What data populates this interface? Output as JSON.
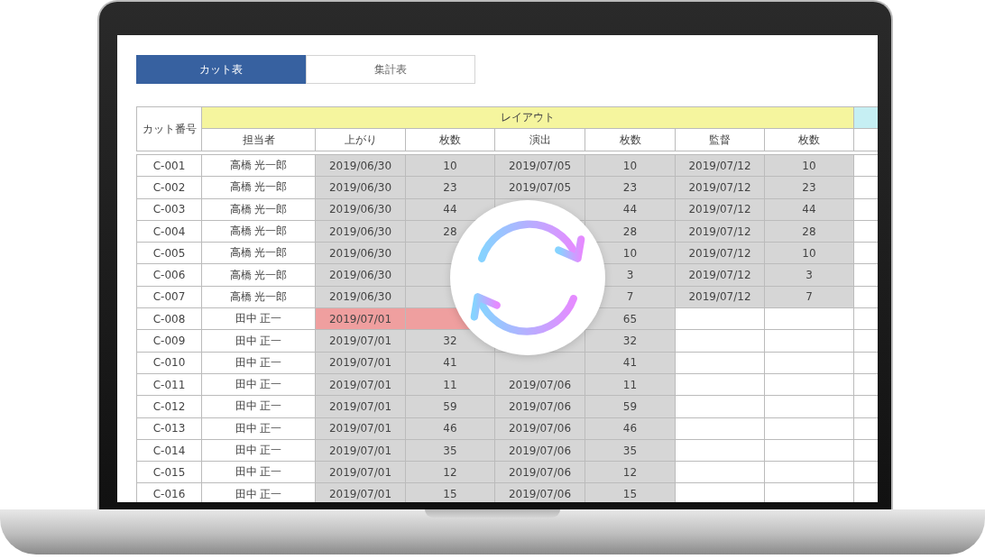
{
  "tabs": [
    {
      "label": "カット表",
      "selected": true
    },
    {
      "label": "集計表",
      "selected": false
    }
  ],
  "table": {
    "corner": "カット番号",
    "group": "レイアウト",
    "columns": [
      "担当者",
      "上がり",
      "枚数",
      "演出",
      "枚数",
      "監督",
      "枚数"
    ],
    "rows": [
      {
        "cut": "C-001",
        "staff": "高橋 光一郎",
        "up": {
          "done": true,
          "late": false,
          "date": "2019/06/30",
          "count": "10"
        },
        "direction": {
          "done": true,
          "late": false,
          "date": "2019/07/05",
          "count": "10"
        },
        "director": {
          "done": true,
          "late": false,
          "date": "2019/07/12",
          "count": "10"
        }
      },
      {
        "cut": "C-002",
        "staff": "高橋 光一郎",
        "up": {
          "done": true,
          "late": false,
          "date": "2019/06/30",
          "count": "23"
        },
        "direction": {
          "done": true,
          "late": false,
          "date": "2019/07/05",
          "count": "23"
        },
        "director": {
          "done": true,
          "late": false,
          "date": "2019/07/12",
          "count": "23"
        }
      },
      {
        "cut": "C-003",
        "staff": "高橋 光一郎",
        "up": {
          "done": true,
          "late": false,
          "date": "2019/06/30",
          "count": "44"
        },
        "direction": {
          "done": true,
          "late": false,
          "count": "44"
        },
        "director": {
          "done": true,
          "late": false,
          "date": "2019/07/12",
          "count": "44"
        }
      },
      {
        "cut": "C-004",
        "staff": "高橋 光一郎",
        "up": {
          "done": true,
          "late": false,
          "date": "2019/06/30",
          "count": "28"
        },
        "direction": {
          "done": true,
          "late": false,
          "count": "28"
        },
        "director": {
          "done": true,
          "late": false,
          "date": "2019/07/12",
          "count": "28"
        }
      },
      {
        "cut": "C-005",
        "staff": "高橋 光一郎",
        "up": {
          "done": true,
          "late": false,
          "date": "2019/06/30"
        },
        "direction": {
          "done": true,
          "late": false,
          "count": "10"
        },
        "director": {
          "done": true,
          "late": false,
          "date": "2019/07/12",
          "count": "10"
        }
      },
      {
        "cut": "C-006",
        "staff": "高橋 光一郎",
        "up": {
          "done": true,
          "late": false,
          "date": "2019/06/30"
        },
        "direction": {
          "done": true,
          "late": false,
          "count": "3"
        },
        "director": {
          "done": true,
          "late": false,
          "date": "2019/07/12",
          "count": "3"
        }
      },
      {
        "cut": "C-007",
        "staff": "高橋 光一郎",
        "up": {
          "done": true,
          "late": false,
          "date": "2019/06/30"
        },
        "direction": {
          "done": true,
          "late": false,
          "count": "7"
        },
        "director": {
          "done": true,
          "late": false,
          "date": "2019/07/12",
          "count": "7"
        }
      },
      {
        "cut": "C-008",
        "staff": "田中 正一",
        "up": {
          "done": false,
          "late": true,
          "date": "2019/07/01"
        },
        "direction": {
          "done": true,
          "late": false,
          "count": "65"
        },
        "director": {
          "done": false,
          "late": false
        }
      },
      {
        "cut": "C-009",
        "staff": "田中 正一",
        "up": {
          "done": true,
          "late": false,
          "date": "2019/07/01",
          "count": "32"
        },
        "direction": {
          "done": true,
          "late": false,
          "count": "32"
        },
        "director": {
          "done": false,
          "late": false
        }
      },
      {
        "cut": "C-010",
        "staff": "田中 正一",
        "up": {
          "done": true,
          "late": false,
          "date": "2019/07/01",
          "count": "41"
        },
        "direction": {
          "done": true,
          "late": false,
          "count": "41"
        },
        "director": {
          "done": false,
          "late": false
        }
      },
      {
        "cut": "C-011",
        "staff": "田中 正一",
        "up": {
          "done": true,
          "late": false,
          "date": "2019/07/01",
          "count": "11"
        },
        "direction": {
          "done": true,
          "late": false,
          "date": "2019/07/06",
          "count": "11"
        },
        "director": {
          "done": false,
          "late": false
        }
      },
      {
        "cut": "C-012",
        "staff": "田中 正一",
        "up": {
          "done": true,
          "late": false,
          "date": "2019/07/01",
          "count": "59"
        },
        "direction": {
          "done": true,
          "late": false,
          "date": "2019/07/06",
          "count": "59"
        },
        "director": {
          "done": false,
          "late": false
        }
      },
      {
        "cut": "C-013",
        "staff": "田中 正一",
        "up": {
          "done": true,
          "late": false,
          "date": "2019/07/01",
          "count": "46"
        },
        "direction": {
          "done": true,
          "late": false,
          "date": "2019/07/06",
          "count": "46"
        },
        "director": {
          "done": false,
          "late": false
        }
      },
      {
        "cut": "C-014",
        "staff": "田中 正一",
        "up": {
          "done": true,
          "late": false,
          "date": "2019/07/01",
          "count": "35"
        },
        "direction": {
          "done": true,
          "late": false,
          "date": "2019/07/06",
          "count": "35"
        },
        "director": {
          "done": false,
          "late": false
        }
      },
      {
        "cut": "C-015",
        "staff": "田中 正一",
        "up": {
          "done": true,
          "late": false,
          "date": "2019/07/01",
          "count": "12"
        },
        "direction": {
          "done": true,
          "late": false,
          "date": "2019/07/06",
          "count": "12"
        },
        "director": {
          "done": false,
          "late": false
        }
      },
      {
        "cut": "C-016",
        "staff": "田中 正一",
        "up": {
          "done": true,
          "late": false,
          "date": "2019/07/01",
          "count": "15"
        },
        "direction": {
          "done": true,
          "late": false,
          "date": "2019/07/06",
          "count": "15"
        },
        "director": {
          "done": false,
          "late": false
        }
      }
    ]
  }
}
